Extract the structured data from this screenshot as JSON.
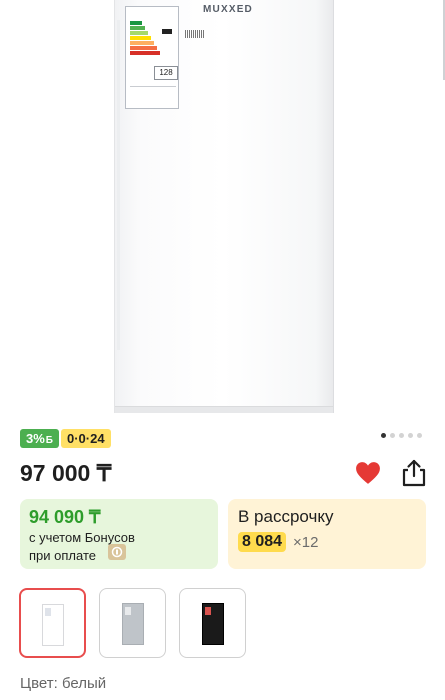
{
  "product_image": {
    "brand_text": "MUXXED",
    "energy_number": "128",
    "icon": "refrigerator-photo"
  },
  "carousel": {
    "count": 5,
    "active_index": 0
  },
  "badges": {
    "bonus_text": "3%",
    "bonus_symbol": "Б",
    "installment_text": "0·0·24"
  },
  "price": {
    "value": "97 000 ₸"
  },
  "actions": {
    "favorite_icon": "heart-icon",
    "share_icon": "share-icon",
    "favorite_color": "#e53935"
  },
  "bonus_card": {
    "price": "94 090 ₸",
    "line1": "с учетом Бонусов",
    "line2": "при оплате"
  },
  "installment_card": {
    "title": "В рассрочку",
    "amount": "8 084",
    "multiplier": "×12"
  },
  "thumbnails": [
    {
      "variant": "white",
      "selected": true,
      "color": "#ffffff"
    },
    {
      "variant": "silver",
      "selected": false,
      "color": "#bfc4c9"
    },
    {
      "variant": "black",
      "selected": false,
      "color": "#1a1a1a"
    }
  ],
  "color_line": "Цвет: белый",
  "colors": {
    "bonus_green": "#4caf50",
    "installment_yellow": "#ffe066",
    "select_red": "#e84d4d"
  }
}
